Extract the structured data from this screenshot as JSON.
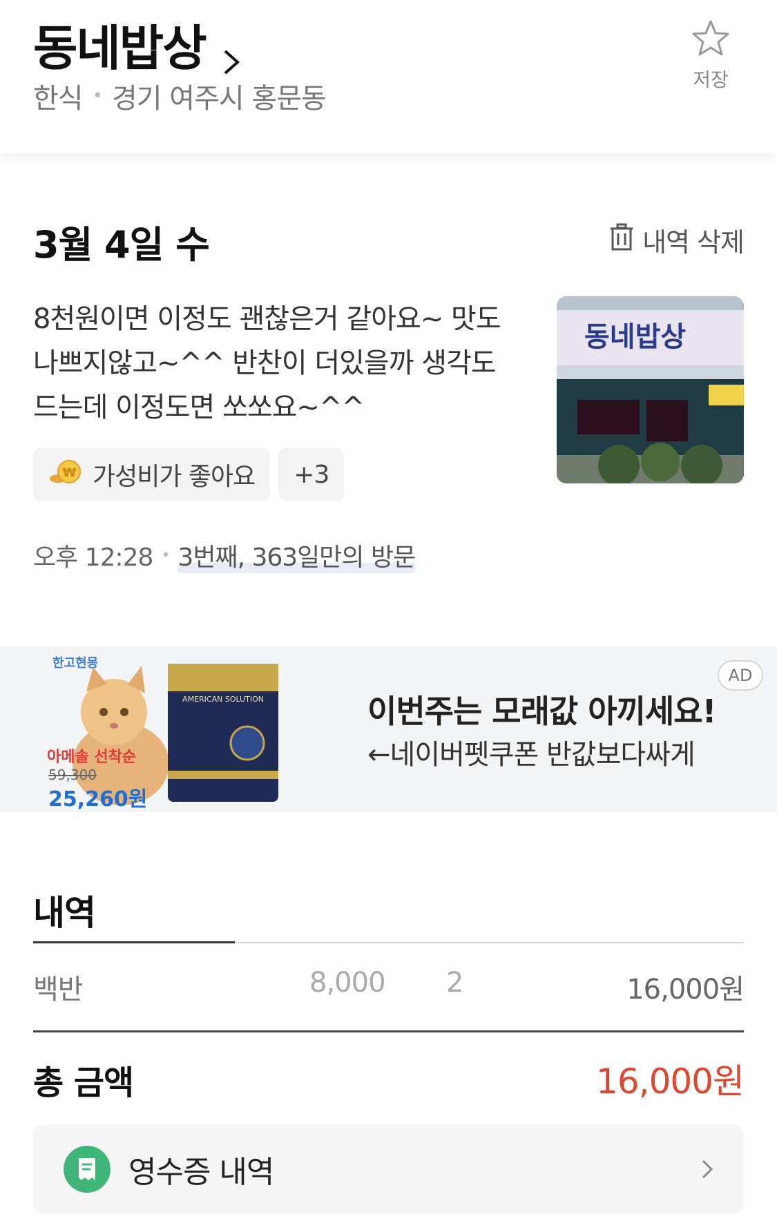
{
  "header": {
    "store_name": "동네밥상",
    "category": "한식",
    "location": "경기 여주시 홍문동",
    "save_label": "저장"
  },
  "visit": {
    "date": "3월 4일 수",
    "delete_label": "내역 삭제",
    "review": "8천원이면 이정도 괜찮은거 같아요~ 맛도 나쁘지않고~^^ 반찬이 더있을까 생각도 드는데 이정도면 쏘쏘요~^^",
    "photo_sign_text": "동네밥상",
    "tags": [
      {
        "label": "가성비가 좋아요",
        "icon": "coin-icon"
      },
      {
        "label": "+3"
      }
    ],
    "time": "오후 12:28",
    "visit_count": "3번째, 363일만의 방문"
  },
  "ad": {
    "badge": "AD",
    "headline": "이번주는 모래값 아끼세요!",
    "subline": "←네이버펫쿠폰 반값보다싸게",
    "brand": "한고현몽",
    "promo": "아메솔 선착순",
    "old_price": "59,300",
    "new_price": "25,260원",
    "bag_text": "AMERICAN SOLUTION"
  },
  "details": {
    "title": "내역",
    "items": [
      {
        "name": "백반",
        "price": "8,000",
        "qty": "2",
        "total": "16,000원"
      }
    ],
    "total_label": "총 금액",
    "total_value": "16,000원"
  },
  "receipt": {
    "label": "영수증 내역"
  },
  "colors": {
    "accent_red": "#e0462e",
    "receipt_green": "#3fb57a"
  }
}
